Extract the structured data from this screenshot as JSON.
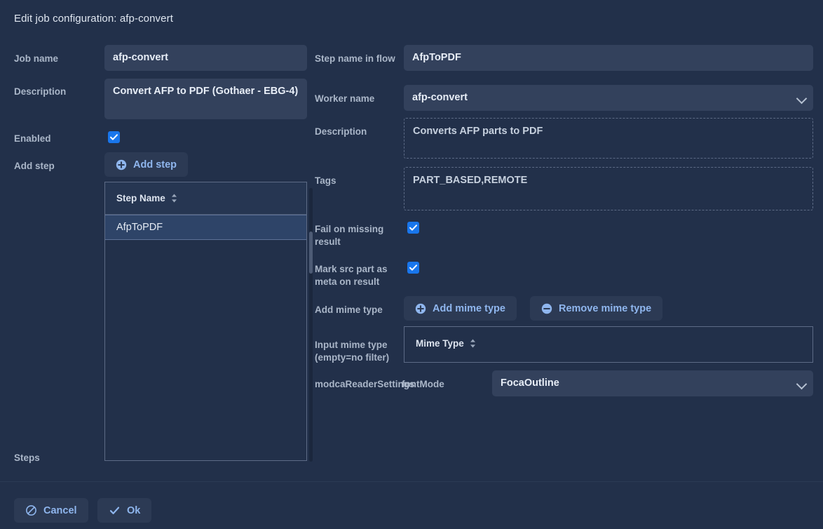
{
  "dialog": {
    "title": "Edit job configuration: afp-convert"
  },
  "left_panel": {
    "job_name": {
      "label": "Job name",
      "value": "afp-convert"
    },
    "description": {
      "label": "Description",
      "value": "Convert AFP to PDF (Gothaer - EBG-4)"
    },
    "enabled": {
      "label": "Enabled",
      "checked": true
    },
    "add_step": {
      "label": "Add step",
      "button_label": "Add step",
      "icon": "plus-circle-icon"
    },
    "steps": {
      "label": "Steps",
      "columns": [
        "Step Name"
      ],
      "rows": [
        {
          "step_name": "AfpToPDF",
          "selected": true
        }
      ]
    }
  },
  "right_panel": {
    "step_name_in_flow": {
      "label": "Step name in flow",
      "value": "AfpToPDF"
    },
    "worker_name": {
      "label": "Worker name",
      "value": "afp-convert",
      "icon": "chevron-down-icon"
    },
    "description": {
      "label": "Description",
      "value": "Converts AFP parts to PDF"
    },
    "tags": {
      "label": "Tags",
      "value": "PART_BASED,REMOTE"
    },
    "fail_on_missing_result": {
      "label": "Fail on missing result",
      "checked": true
    },
    "mark_src_part_as_meta": {
      "label": "Mark src part as meta on result",
      "checked": true
    },
    "add_mime_type": {
      "label": "Add mime type",
      "add_button_label": "Add mime type",
      "add_icon": "plus-circle-icon",
      "remove_button_label": "Remove mime type",
      "remove_icon": "minus-circle-icon"
    },
    "input_mime_type": {
      "label": "Input mime type (empty=no filter)",
      "columns": [
        "Mime Type"
      ],
      "rows": []
    },
    "modca_reader_settings": {
      "label": "modcaReaderSettings",
      "sub_label": "fontMode",
      "value": "FocaOutline",
      "icon": "chevron-down-icon"
    }
  },
  "footer": {
    "cancel": {
      "label": "Cancel",
      "icon": "ban-icon"
    },
    "ok": {
      "label": "Ok",
      "icon": "check-icon"
    }
  },
  "colors": {
    "background": "#22304a",
    "field_background": "#33415c",
    "accent": "#1976ec",
    "link_text": "#8fb6ee",
    "label_text": "#aab6c8",
    "selected_row": "#2e4468"
  }
}
